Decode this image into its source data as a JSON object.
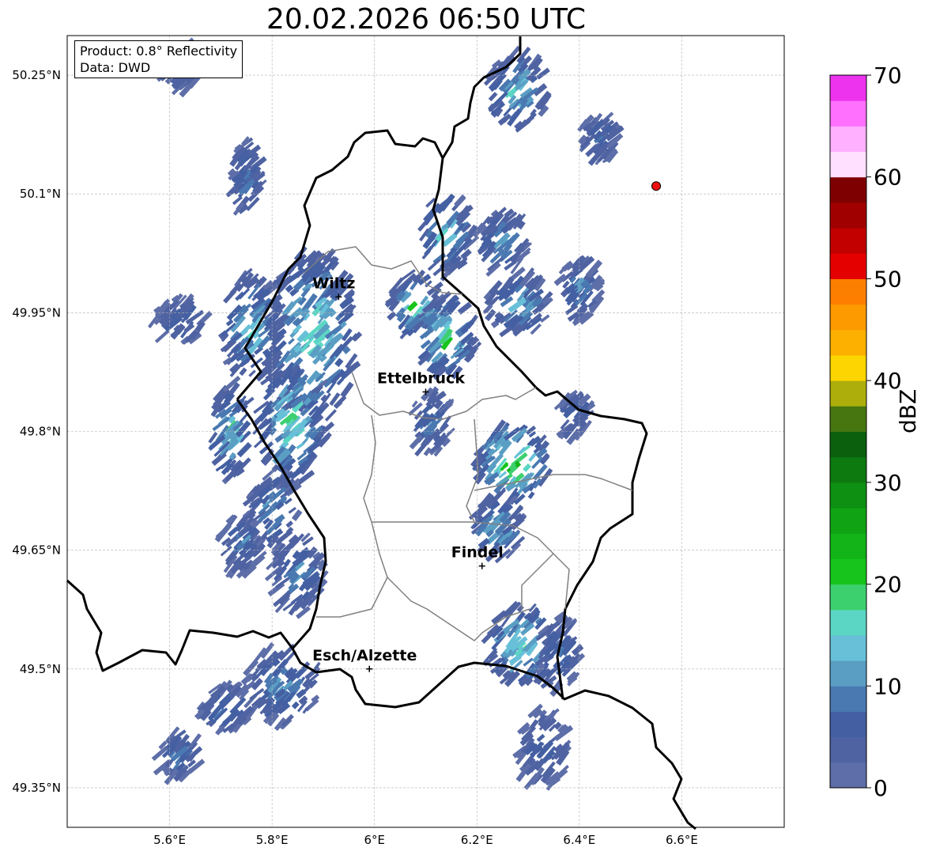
{
  "title": "20.02.2026 06:50 UTC",
  "info": {
    "product": "Product: 0.8° Reflectivity",
    "data": "Data: DWD"
  },
  "lat_ticks": [
    {
      "value": 50.25,
      "label": "50.25°N"
    },
    {
      "value": 50.1,
      "label": "50.1°N"
    },
    {
      "value": 49.95,
      "label": "49.95°N"
    },
    {
      "value": 49.8,
      "label": "49.8°N"
    },
    {
      "value": 49.65,
      "label": "49.65°N"
    },
    {
      "value": 49.5,
      "label": "49.5°N"
    },
    {
      "value": 49.35,
      "label": "49.35°N"
    }
  ],
  "lon_ticks": [
    {
      "value": 5.6,
      "label": "5.6°E"
    },
    {
      "value": 5.8,
      "label": "5.8°E"
    },
    {
      "value": 6.0,
      "label": "6°E"
    },
    {
      "value": 6.2,
      "label": "6.2°E"
    },
    {
      "value": 6.4,
      "label": "6.4°E"
    },
    {
      "value": 6.6,
      "label": "6.6°E"
    }
  ],
  "extent": {
    "lon_min": 5.4,
    "lon_max": 6.8,
    "lat_min": 49.3,
    "lat_max": 50.3
  },
  "cities": [
    {
      "name": "Wiltz",
      "lon": 5.93,
      "lat": 49.97
    },
    {
      "name": "Ettelbruck",
      "lon": 6.1,
      "lat": 49.85
    },
    {
      "name": "Findel",
      "lon": 6.21,
      "lat": 49.63
    },
    {
      "name": "Esch/Alzette",
      "lon": 5.99,
      "lat": 49.5
    }
  ],
  "radar_site": {
    "lon": 6.55,
    "lat": 50.11,
    "color": "#ee1111"
  },
  "colorbar": {
    "unit": "dBZ",
    "min": 0,
    "max": 70,
    "step": 2.5,
    "tick_labels": [
      "0",
      "10",
      "20",
      "30",
      "40",
      "50",
      "60",
      "70"
    ],
    "colors": [
      "#5d6ea8",
      "#4f63a2",
      "#4460a3",
      "#4a79b1",
      "#5a9ec4",
      "#67c0d8",
      "#5cd6c4",
      "#3dd06f",
      "#16c41c",
      "#12b418",
      "#10a414",
      "#0e9012",
      "#0d7a10",
      "#0b600e",
      "#477611",
      "#adae0b",
      "#fdd500",
      "#fdb000",
      "#fd9a00",
      "#fd7f00",
      "#e50000",
      "#c20000",
      "#a10000",
      "#7f0000",
      "#ffe0ff",
      "#ffb0ff",
      "#ff70ff",
      "#ee33ee"
    ]
  },
  "echoes": [
    {
      "lon": 5.88,
      "lat": 49.92,
      "rx": 0.09,
      "ry": 0.11,
      "max_dbz": 22
    },
    {
      "lon": 5.76,
      "lat": 49.93,
      "rx": 0.06,
      "ry": 0.07,
      "max_dbz": 18
    },
    {
      "lon": 5.62,
      "lat": 49.94,
      "rx": 0.05,
      "ry": 0.03,
      "max_dbz": 10
    },
    {
      "lon": 5.84,
      "lat": 49.81,
      "rx": 0.07,
      "ry": 0.08,
      "max_dbz": 22
    },
    {
      "lon": 5.72,
      "lat": 49.8,
      "rx": 0.04,
      "ry": 0.06,
      "max_dbz": 20
    },
    {
      "lon": 5.8,
      "lat": 49.7,
      "rx": 0.05,
      "ry": 0.05,
      "max_dbz": 14
    },
    {
      "lon": 5.74,
      "lat": 49.66,
      "rx": 0.04,
      "ry": 0.04,
      "max_dbz": 12
    },
    {
      "lon": 5.85,
      "lat": 49.62,
      "rx": 0.05,
      "ry": 0.05,
      "max_dbz": 14
    },
    {
      "lon": 5.82,
      "lat": 49.48,
      "rx": 0.07,
      "ry": 0.05,
      "max_dbz": 14
    },
    {
      "lon": 5.71,
      "lat": 49.45,
      "rx": 0.05,
      "ry": 0.03,
      "max_dbz": 12
    },
    {
      "lon": 5.62,
      "lat": 49.39,
      "rx": 0.04,
      "ry": 0.03,
      "max_dbz": 12
    },
    {
      "lon": 6.08,
      "lat": 49.96,
      "rx": 0.05,
      "ry": 0.04,
      "max_dbz": 24
    },
    {
      "lon": 6.14,
      "lat": 49.92,
      "rx": 0.06,
      "ry": 0.05,
      "max_dbz": 24
    },
    {
      "lon": 6.14,
      "lat": 50.05,
      "rx": 0.05,
      "ry": 0.05,
      "max_dbz": 22
    },
    {
      "lon": 6.25,
      "lat": 50.04,
      "rx": 0.05,
      "ry": 0.04,
      "max_dbz": 14
    },
    {
      "lon": 6.28,
      "lat": 49.96,
      "rx": 0.06,
      "ry": 0.04,
      "max_dbz": 16
    },
    {
      "lon": 6.28,
      "lat": 50.23,
      "rx": 0.06,
      "ry": 0.05,
      "max_dbz": 18
    },
    {
      "lon": 6.44,
      "lat": 50.17,
      "rx": 0.04,
      "ry": 0.03,
      "max_dbz": 10
    },
    {
      "lon": 6.4,
      "lat": 49.98,
      "rx": 0.04,
      "ry": 0.04,
      "max_dbz": 12
    },
    {
      "lon": 6.27,
      "lat": 49.76,
      "rx": 0.07,
      "ry": 0.05,
      "max_dbz": 30
    },
    {
      "lon": 6.24,
      "lat": 49.68,
      "rx": 0.05,
      "ry": 0.04,
      "max_dbz": 18
    },
    {
      "lon": 6.29,
      "lat": 49.53,
      "rx": 0.07,
      "ry": 0.05,
      "max_dbz": 22
    },
    {
      "lon": 6.36,
      "lat": 49.52,
      "rx": 0.04,
      "ry": 0.05,
      "max_dbz": 12
    },
    {
      "lon": 6.33,
      "lat": 49.4,
      "rx": 0.05,
      "ry": 0.05,
      "max_dbz": 10
    },
    {
      "lon": 6.11,
      "lat": 49.81,
      "rx": 0.04,
      "ry": 0.04,
      "max_dbz": 12
    },
    {
      "lon": 6.39,
      "lat": 49.82,
      "rx": 0.03,
      "ry": 0.03,
      "max_dbz": 10
    },
    {
      "lon": 5.62,
      "lat": 50.26,
      "rx": 0.04,
      "ry": 0.03,
      "max_dbz": 10
    },
    {
      "lon": 5.75,
      "lat": 50.12,
      "rx": 0.03,
      "ry": 0.05,
      "max_dbz": 12
    }
  ]
}
